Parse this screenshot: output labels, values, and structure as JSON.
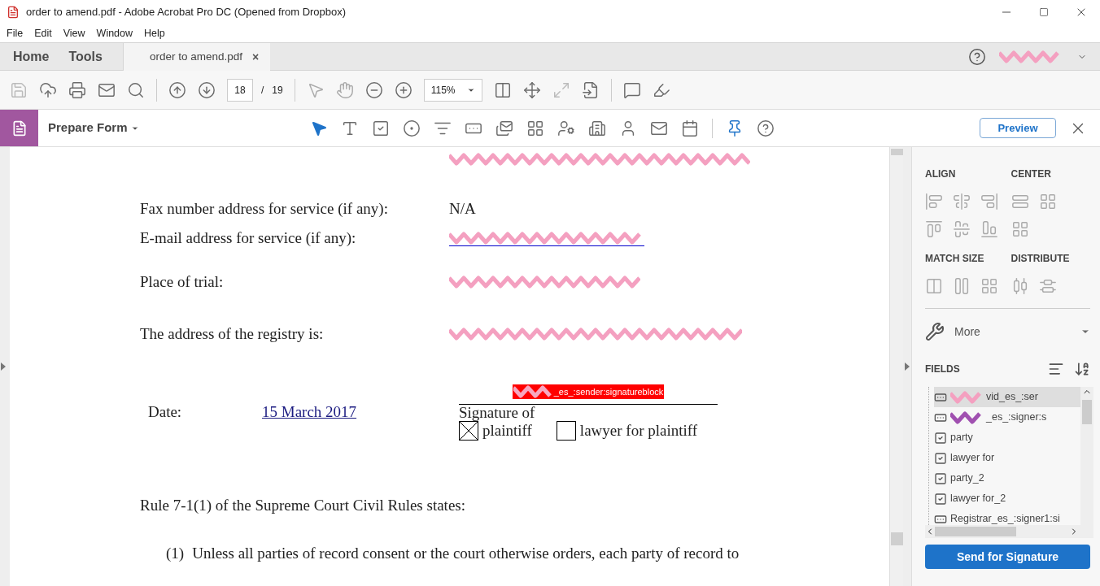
{
  "window": {
    "title": "order to amend.pdf - Adobe Acrobat Pro DC (Opened from Dropbox)"
  },
  "menu": [
    "File",
    "Edit",
    "View",
    "Window",
    "Help"
  ],
  "nav_tabs": [
    {
      "label": "Home"
    },
    {
      "label": "Tools"
    }
  ],
  "document_tab": {
    "label": "order to amend.pdf",
    "close": "×"
  },
  "toolbar": {
    "page_number": "18",
    "page_separator": "/",
    "page_count": "19",
    "zoom": "115%"
  },
  "prepare_form": {
    "title": "Prepare Form",
    "preview_button": "Preview"
  },
  "document": {
    "rows": [
      {
        "kind": "redacted"
      },
      {
        "label": "Fax number address for service (if any):",
        "value": "N/A",
        "kind": "text"
      },
      {
        "label": "E-mail address for service (if any):",
        "kind": "redacted_link"
      },
      {
        "label": "Place of trial:",
        "kind": "redacted"
      },
      {
        "label": "The address of the registry is:",
        "kind": "redacted"
      }
    ],
    "date_label": "Date:",
    "date_value": "15 March 2017",
    "signature": {
      "field_label": "_es_:sender:signatureblock",
      "caption": "Signature of",
      "options": [
        {
          "label": "plaintiff",
          "checked": true
        },
        {
          "label": "lawyer for plaintiff",
          "checked": false
        }
      ]
    },
    "rule_heading": "Rule 7-1(1) of the Supreme Court Civil Rules states:",
    "rule_item": {
      "number": "(1)",
      "text": "Unless all parties of record consent or the court otherwise orders, each party of record to"
    }
  },
  "right_panel": {
    "sections": [
      "ALIGN",
      "CENTER",
      "MATCH SIZE",
      "DISTRIBUTE"
    ],
    "more": "More",
    "fields_title": "FIELDS",
    "fields": [
      {
        "kind": "signature",
        "label": "vid_es_:ser",
        "redacted": true,
        "selected": true
      },
      {
        "kind": "signature",
        "label": "_es_:signer:s",
        "redacted": true,
        "selected": false
      },
      {
        "kind": "checkbox",
        "label": "party",
        "redacted": false,
        "selected": false
      },
      {
        "kind": "checkbox",
        "label": "lawyer for",
        "redacted": false,
        "selected": false
      },
      {
        "kind": "checkbox",
        "label": "party_2",
        "redacted": false,
        "selected": false
      },
      {
        "kind": "checkbox",
        "label": "lawyer for_2",
        "redacted": false,
        "selected": false
      },
      {
        "kind": "signature",
        "label": "Registrar_es_:signer1:si",
        "redacted": false,
        "selected": false
      }
    ],
    "send_button": "Send for Signature"
  }
}
